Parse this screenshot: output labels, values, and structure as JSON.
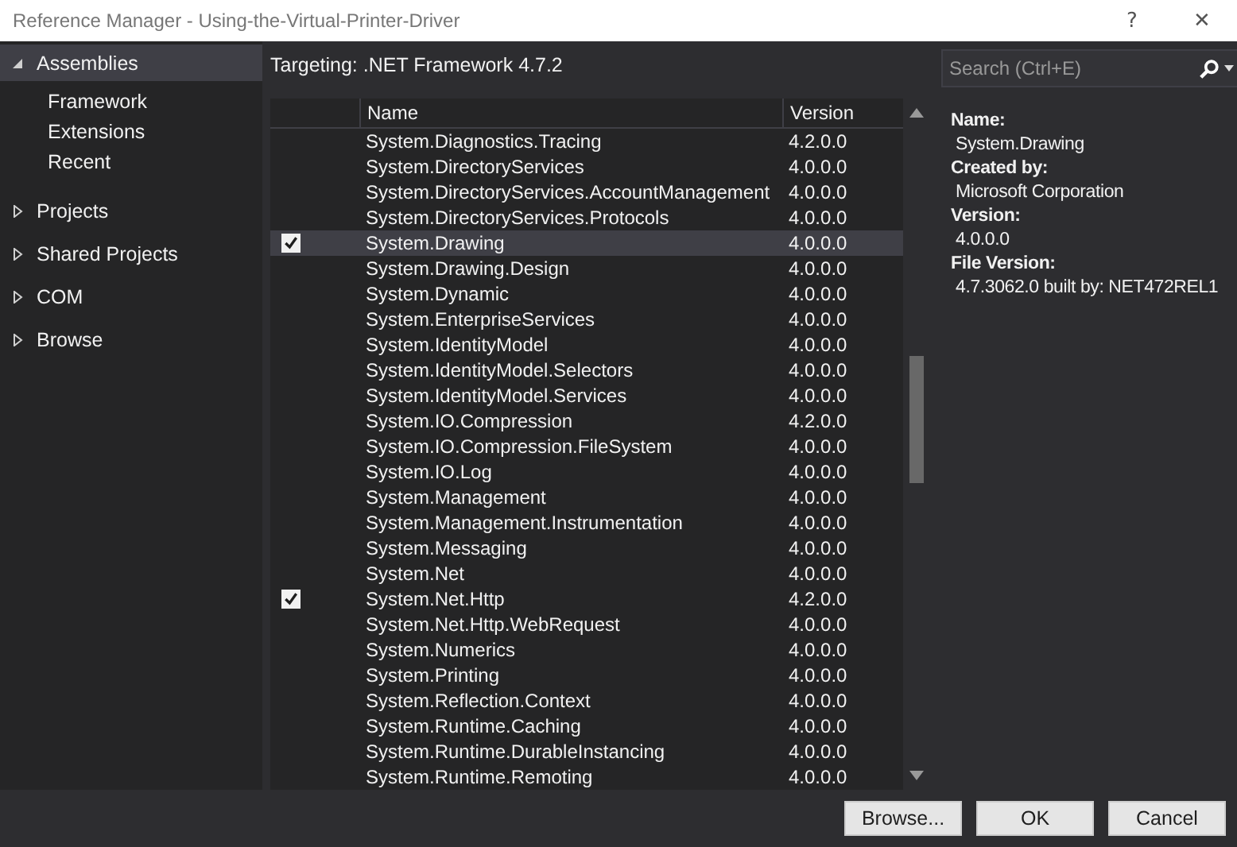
{
  "window": {
    "title": "Reference Manager - Using-the-Virtual-Printer-Driver",
    "help": "?",
    "close": "✕"
  },
  "sidebar": {
    "items": [
      {
        "label": "Assemblies",
        "expanded": true,
        "selected": true,
        "children": [
          {
            "label": "Framework"
          },
          {
            "label": "Extensions"
          },
          {
            "label": "Recent"
          }
        ]
      },
      {
        "label": "Projects",
        "expanded": false,
        "selected": false
      },
      {
        "label": "Shared Projects",
        "expanded": false,
        "selected": false
      },
      {
        "label": "COM",
        "expanded": false,
        "selected": false
      },
      {
        "label": "Browse",
        "expanded": false,
        "selected": false
      }
    ]
  },
  "targeting": "Targeting: .NET Framework 4.7.2",
  "search": {
    "placeholder": "Search (Ctrl+E)"
  },
  "table": {
    "columns": [
      "Name",
      "Version"
    ],
    "rows": [
      {
        "name": "System.Diagnostics.Tracing",
        "version": "4.2.0.0",
        "checked": false,
        "selected": false
      },
      {
        "name": "System.DirectoryServices",
        "version": "4.0.0.0",
        "checked": false,
        "selected": false
      },
      {
        "name": "System.DirectoryServices.AccountManagement",
        "version": "4.0.0.0",
        "checked": false,
        "selected": false
      },
      {
        "name": "System.DirectoryServices.Protocols",
        "version": "4.0.0.0",
        "checked": false,
        "selected": false
      },
      {
        "name": "System.Drawing",
        "version": "4.0.0.0",
        "checked": true,
        "selected": true
      },
      {
        "name": "System.Drawing.Design",
        "version": "4.0.0.0",
        "checked": false,
        "selected": false
      },
      {
        "name": "System.Dynamic",
        "version": "4.0.0.0",
        "checked": false,
        "selected": false
      },
      {
        "name": "System.EnterpriseServices",
        "version": "4.0.0.0",
        "checked": false,
        "selected": false
      },
      {
        "name": "System.IdentityModel",
        "version": "4.0.0.0",
        "checked": false,
        "selected": false
      },
      {
        "name": "System.IdentityModel.Selectors",
        "version": "4.0.0.0",
        "checked": false,
        "selected": false
      },
      {
        "name": "System.IdentityModel.Services",
        "version": "4.0.0.0",
        "checked": false,
        "selected": false
      },
      {
        "name": "System.IO.Compression",
        "version": "4.2.0.0",
        "checked": false,
        "selected": false
      },
      {
        "name": "System.IO.Compression.FileSystem",
        "version": "4.0.0.0",
        "checked": false,
        "selected": false
      },
      {
        "name": "System.IO.Log",
        "version": "4.0.0.0",
        "checked": false,
        "selected": false
      },
      {
        "name": "System.Management",
        "version": "4.0.0.0",
        "checked": false,
        "selected": false
      },
      {
        "name": "System.Management.Instrumentation",
        "version": "4.0.0.0",
        "checked": false,
        "selected": false
      },
      {
        "name": "System.Messaging",
        "version": "4.0.0.0",
        "checked": false,
        "selected": false
      },
      {
        "name": "System.Net",
        "version": "4.0.0.0",
        "checked": false,
        "selected": false
      },
      {
        "name": "System.Net.Http",
        "version": "4.2.0.0",
        "checked": true,
        "selected": false
      },
      {
        "name": "System.Net.Http.WebRequest",
        "version": "4.0.0.0",
        "checked": false,
        "selected": false
      },
      {
        "name": "System.Numerics",
        "version": "4.0.0.0",
        "checked": false,
        "selected": false
      },
      {
        "name": "System.Printing",
        "version": "4.0.0.0",
        "checked": false,
        "selected": false
      },
      {
        "name": "System.Reflection.Context",
        "version": "4.0.0.0",
        "checked": false,
        "selected": false
      },
      {
        "name": "System.Runtime.Caching",
        "version": "4.0.0.0",
        "checked": false,
        "selected": false
      },
      {
        "name": "System.Runtime.DurableInstancing",
        "version": "4.0.0.0",
        "checked": false,
        "selected": false
      },
      {
        "name": "System.Runtime.Remoting",
        "version": "4.0.0.0",
        "checked": false,
        "selected": false
      }
    ]
  },
  "details": [
    {
      "label": "Name:",
      "value": "System.Drawing"
    },
    {
      "label": "Created by:",
      "value": "Microsoft Corporation"
    },
    {
      "label": "Version:",
      "value": "4.0.0.0"
    },
    {
      "label": "File Version:",
      "value": "4.7.3062.0 built by: NET472REL1"
    }
  ],
  "buttons": [
    "Browse...",
    "OK",
    "Cancel"
  ]
}
